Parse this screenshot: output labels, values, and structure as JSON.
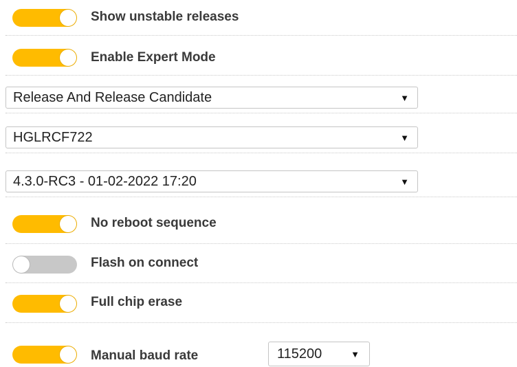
{
  "toggles": {
    "show_unstable": {
      "label": "Show unstable releases",
      "on": true
    },
    "expert_mode": {
      "label": "Enable Expert Mode",
      "on": true
    },
    "no_reboot": {
      "label": "No reboot sequence",
      "on": true
    },
    "flash_on_connect": {
      "label": "Flash on connect",
      "on": false
    },
    "full_chip_erase": {
      "label": "Full chip erase",
      "on": true
    },
    "manual_baud": {
      "label": "Manual baud rate",
      "on": true
    }
  },
  "selects": {
    "release_type": {
      "value": "Release And Release Candidate"
    },
    "board": {
      "value": "HGLRCF722"
    },
    "firmware_version": {
      "value": "4.3.0-RC3 - 01-02-2022 17:20"
    },
    "baud_rate": {
      "value": "115200"
    }
  },
  "icons": {
    "caret": "▼"
  },
  "colors": {
    "toggle_on": "#ffbb00",
    "toggle_off": "#c8c8c8"
  }
}
